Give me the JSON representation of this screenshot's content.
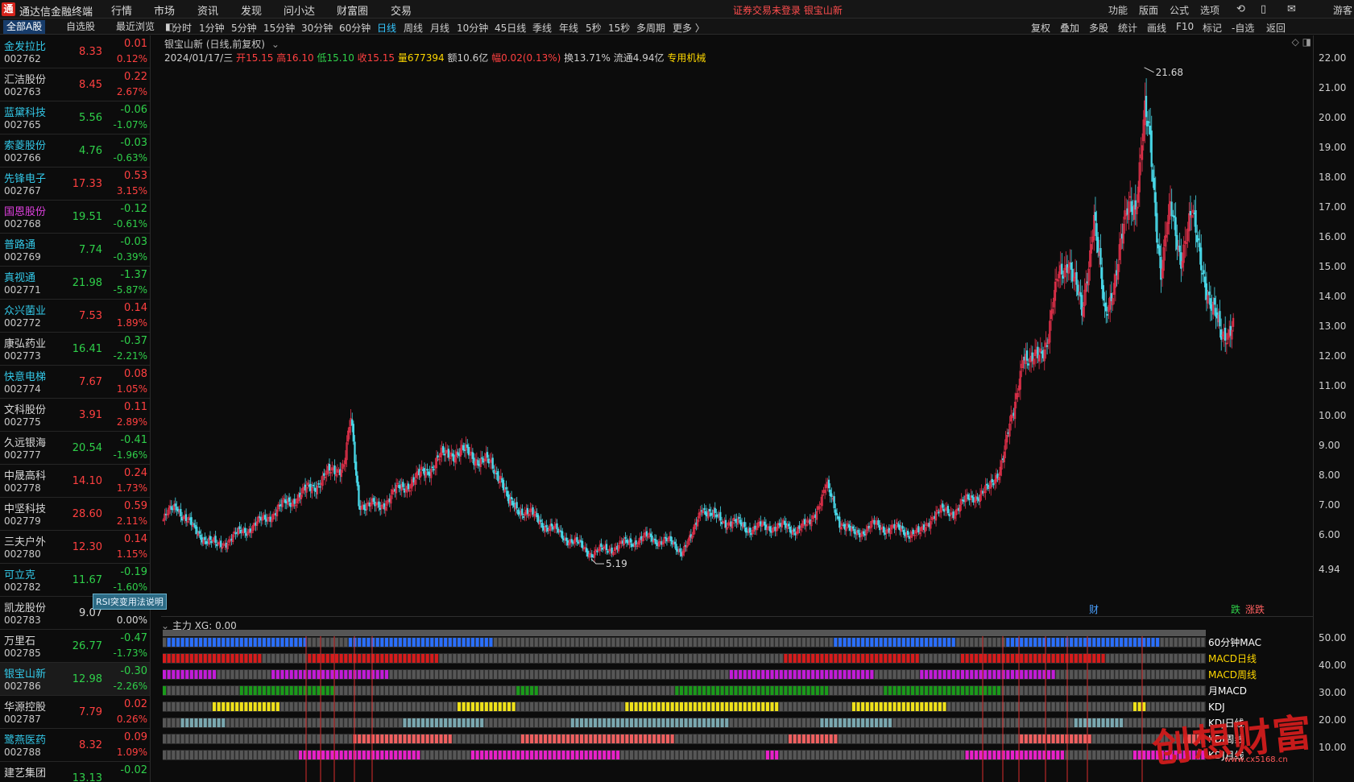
{
  "app": {
    "title": "通达信金融终端"
  },
  "menu": {
    "items": [
      "行情",
      "市场",
      "资讯",
      "发现",
      "问小达",
      "财富圈",
      "交易"
    ],
    "notice": "证券交易未登录  银宝山新",
    "right": [
      "功能",
      "版面",
      "公式",
      "选项"
    ],
    "guest": "游客"
  },
  "sidebar": {
    "tabs": [
      "全部A股",
      "自选股",
      "最近浏览"
    ],
    "tooltip": "RSI突变用法说明",
    "stocks": [
      {
        "name": "金发拉比",
        "code": "002762",
        "price": "8.33",
        "chg": "0.01",
        "pct": "0.12%",
        "dir": "up",
        "nameColor": "#33c8e8"
      },
      {
        "name": "汇洁股份",
        "code": "002763",
        "price": "8.45",
        "chg": "0.22",
        "pct": "2.67%",
        "dir": "up",
        "nameColor": "#d8d8d8"
      },
      {
        "name": "蓝黛科技",
        "code": "002765",
        "price": "5.56",
        "chg": "-0.06",
        "pct": "-1.07%",
        "dir": "dn",
        "nameColor": "#33c8e8"
      },
      {
        "name": "索菱股份",
        "code": "002766",
        "price": "4.76",
        "chg": "-0.03",
        "pct": "-0.63%",
        "dir": "dn",
        "nameColor": "#33c8e8"
      },
      {
        "name": "先锋电子",
        "code": "002767",
        "price": "17.33",
        "chg": "0.53",
        "pct": "3.15%",
        "dir": "up",
        "nameColor": "#33c8e8"
      },
      {
        "name": "国恩股份",
        "code": "002768",
        "price": "19.51",
        "chg": "-0.12",
        "pct": "-0.61%",
        "dir": "dn",
        "nameColor": "#e040e0"
      },
      {
        "name": "普路通",
        "code": "002769",
        "price": "7.74",
        "chg": "-0.03",
        "pct": "-0.39%",
        "dir": "dn",
        "nameColor": "#33c8e8"
      },
      {
        "name": "真视通",
        "code": "002771",
        "price": "21.98",
        "chg": "-1.37",
        "pct": "-5.87%",
        "dir": "dn",
        "nameColor": "#33c8e8"
      },
      {
        "name": "众兴菌业",
        "code": "002772",
        "price": "7.53",
        "chg": "0.14",
        "pct": "1.89%",
        "dir": "up",
        "nameColor": "#33c8e8"
      },
      {
        "name": "康弘药业",
        "code": "002773",
        "price": "16.41",
        "chg": "-0.37",
        "pct": "-2.21%",
        "dir": "dn",
        "nameColor": "#d8d8d8"
      },
      {
        "name": "快意电梯",
        "code": "002774",
        "price": "7.67",
        "chg": "0.08",
        "pct": "1.05%",
        "dir": "up",
        "nameColor": "#33c8e8"
      },
      {
        "name": "文科股份",
        "code": "002775",
        "price": "3.91",
        "chg": "0.11",
        "pct": "2.89%",
        "dir": "up",
        "nameColor": "#d8d8d8"
      },
      {
        "name": "久远银海",
        "code": "002777",
        "price": "20.54",
        "chg": "-0.41",
        "pct": "-1.96%",
        "dir": "dn",
        "nameColor": "#d8d8d8"
      },
      {
        "name": "中晟高科",
        "code": "002778",
        "price": "14.10",
        "chg": "0.24",
        "pct": "1.73%",
        "dir": "up",
        "nameColor": "#d8d8d8"
      },
      {
        "name": "中坚科技",
        "code": "002779",
        "price": "28.60",
        "chg": "0.59",
        "pct": "2.11%",
        "dir": "up",
        "nameColor": "#d8d8d8"
      },
      {
        "name": "三夫户外",
        "code": "002780",
        "price": "12.30",
        "chg": "0.14",
        "pct": "1.15%",
        "dir": "up",
        "nameColor": "#d8d8d8"
      },
      {
        "name": "可立克",
        "code": "002782",
        "price": "11.67",
        "chg": "-0.19",
        "pct": "-1.60%",
        "dir": "dn",
        "nameColor": "#33c8e8"
      },
      {
        "name": "凯龙股份",
        "code": "002783",
        "price": "9.07",
        "chg": "0.00",
        "pct": "0.00%",
        "dir": "fl",
        "nameColor": "#d8d8d8"
      },
      {
        "name": "万里石",
        "code": "002785",
        "price": "26.77",
        "chg": "-0.47",
        "pct": "-1.73%",
        "dir": "dn",
        "nameColor": "#d8d8d8"
      },
      {
        "name": "银宝山新",
        "code": "002786",
        "price": "12.98",
        "chg": "-0.30",
        "pct": "-2.26%",
        "dir": "dn",
        "nameColor": "#33c8e8"
      },
      {
        "name": "华源控股",
        "code": "002787",
        "price": "7.79",
        "chg": "0.02",
        "pct": "0.26%",
        "dir": "up",
        "nameColor": "#d8d8d8"
      },
      {
        "name": "鹭燕医药",
        "code": "002788",
        "price": "8.32",
        "chg": "0.09",
        "pct": "1.09%",
        "dir": "up",
        "nameColor": "#33c8e8"
      },
      {
        "name": "建艺集团",
        "code": "",
        "price": "13.13",
        "chg": "-0.02",
        "pct": "",
        "dir": "dn",
        "nameColor": "#d8d8d8"
      }
    ]
  },
  "periods": [
    "分时",
    "1分钟",
    "5分钟",
    "15分钟",
    "30分钟",
    "60分钟",
    "日线",
    "周线",
    "月线",
    "10分钟",
    "45日线",
    "季线",
    "年线",
    "5秒",
    "15秒",
    "多周期",
    "更多 〉"
  ],
  "activePeriod": "日线",
  "tools": [
    "复权",
    "叠加",
    "多股",
    "统计",
    "画线",
    "F10",
    "标记",
    "-自选",
    "返回"
  ],
  "info": {
    "title": "银宝山新 (日线,前复权)",
    "date": "2024/01/17/三",
    "open_label": "开",
    "open": "15.15",
    "high_label": "高",
    "high": "16.10",
    "low_label": "低",
    "low": "15.10",
    "close_label": "收",
    "close": "15.15",
    "vol_label": "量",
    "vol": "677394",
    "amt_label": "额",
    "amt": "10.6亿",
    "amp_label": "幅",
    "amp": "0.02(0.13%)",
    "turn_label": "换",
    "turn": "13.71%",
    "float_label": "流通",
    "float": "4.94亿",
    "sector": "专用机械"
  },
  "yaxis": {
    "labels": [
      "22.00",
      "21.00",
      "20.00",
      "19.00",
      "18.00",
      "17.00",
      "16.00",
      "15.00",
      "14.00",
      "13.00",
      "12.00",
      "11.00",
      "10.00",
      "9.00",
      "8.00",
      "7.00",
      "6.00"
    ],
    "current": "4.94"
  },
  "markers": {
    "high": "21.68",
    "low": "5.19",
    "cai": "财",
    "die": "跌",
    "tiao": "涨跌"
  },
  "indicator": {
    "header": "主力  XG: 0.00",
    "ylabels": [
      "50.00",
      "40.00",
      "30.00",
      "20.00",
      "10.00"
    ],
    "rows": [
      {
        "label": "60分钟MAC",
        "color": "#2a6fff",
        "labelColor": "#ffffff"
      },
      {
        "label": "MACD日线",
        "color": "#d81b1b",
        "labelColor": "#ffd800"
      },
      {
        "label": "MACD周线",
        "color": "#c21bd8",
        "labelColor": "#ffd800"
      },
      {
        "label": "月MACD",
        "color": "#1a9b1a",
        "labelColor": "#ffffff"
      },
      {
        "label": "KDJ",
        "color": "#f0e21a",
        "labelColor": "#ffffff"
      },
      {
        "label": "KDJ日线",
        "color": "#7aa8b0",
        "labelColor": "#ffffff"
      },
      {
        "label": "KDJ周线",
        "color": "#f06060",
        "labelColor": "#ffffff"
      },
      {
        "label": "KDJ月线",
        "color": "#e820c8",
        "labelColor": "#ffffff"
      }
    ]
  },
  "watermark": {
    "text": "创想财富",
    "url": "www.cx5168.cn"
  },
  "colors": {
    "up": "#ff4040",
    "down": "#2fd04a",
    "candleUp": "#e0304a",
    "candleDown": "#48d8e8",
    "accent": "#35c6ff"
  }
}
